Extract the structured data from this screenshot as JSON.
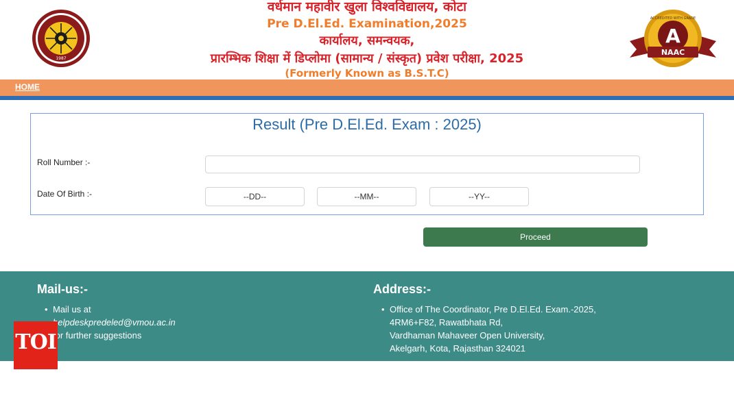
{
  "header": {
    "line1": "वर्धमान महावीर खुला विश्वविद्यालय, कोटा",
    "line2": "Pre D.El.Ed. Examination,2025",
    "line3": "कार्यालय, समन्वयक,",
    "line4": "प्रारम्भिक शिक्षा में डिप्लोमा (सामान्य / संस्कृत) प्रवेश परीक्षा, 2025",
    "line5": "(Formerly Known as B.S.T.C)",
    "naac_top_text": "ACCREDITED WITH GRADE",
    "naac_grade": "A",
    "naac_label": "NAAC",
    "left_logo_year": "1987"
  },
  "nav": {
    "home_label": "HOME"
  },
  "form": {
    "title": "Result (Pre D.El.Ed. Exam : 2025)",
    "roll_label": "Roll Number :-",
    "roll_value": "",
    "dob_label": "Date Of Birth :-",
    "dd_placeholder": "--DD--",
    "mm_placeholder": "--MM--",
    "yy_placeholder": "--YY--",
    "proceed_label": "Proceed"
  },
  "footer": {
    "mail_heading": "Mail-us:-",
    "mail_line1": "Mail us at",
    "mail_email": "helpdeskpredeled@vmou.ac.in",
    "mail_line3": "for further suggestions",
    "address_heading": "Address:-",
    "address_lines": [
      "Office of The Coordinator, Pre D.El.Ed. Exam.-2025,",
      "4RM6+F82, Rawatbhata Rd,",
      "Vardhaman Mahaveer Open University,",
      "Akelgarh, Kota, Rajasthan 324021"
    ]
  },
  "watermark": {
    "text": "TOI"
  },
  "colors": {
    "header_red": "#d8222a",
    "header_orange": "#ef7d2c",
    "nav_orange": "#f0965c",
    "nav_blue": "#2f6db5",
    "title_blue": "#2b6ca8",
    "proceed_green": "#3d7a4e",
    "footer_teal": "#3c8b87",
    "toi_red": "#e2231a"
  }
}
